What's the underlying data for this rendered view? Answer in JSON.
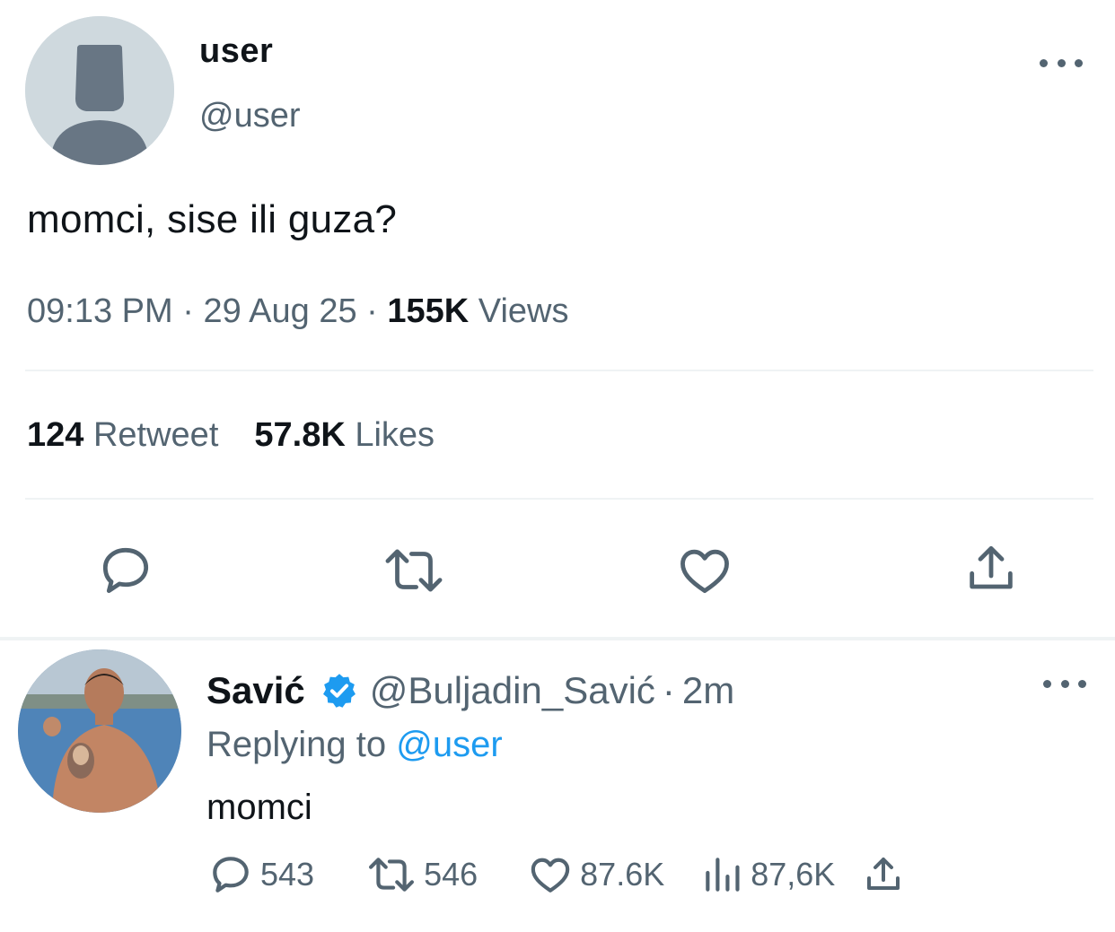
{
  "main_tweet": {
    "display_name": "user",
    "handle": "@user",
    "text": "momci, sise ili guza?",
    "time": "09:13 PM",
    "date": "29 Aug 25",
    "views_count": "155K",
    "views_label": "Views",
    "retweet_count": "124",
    "retweet_label": "Retweet",
    "likes_count": "57.8K",
    "likes_label": "Likes",
    "separator": "·"
  },
  "reply": {
    "display_name": "Savić",
    "handle": "@Buljadin_Savić",
    "time": "2m",
    "separator": "·",
    "replying_label": "Replying to",
    "replying_to": "@user",
    "text": "momci",
    "replies_count": "543",
    "retweets_count": "546",
    "likes_count": "87.6K",
    "views_count": "87,6K"
  },
  "icons": {
    "reply": "speech-bubble-icon",
    "retweet": "retweet-arrows-icon",
    "like": "heart-outline-icon",
    "share": "share-upload-icon",
    "views": "bar-chart-icon",
    "more": "three-dots-icon",
    "verified": "verified-badge-icon"
  },
  "colors": {
    "text_primary": "#0f1419",
    "text_secondary": "#536471",
    "accent_blue": "#1d9bf0",
    "divider": "#eff3f4",
    "default_avatar_bg": "#cfd9de",
    "default_avatar_fg": "#687684"
  }
}
